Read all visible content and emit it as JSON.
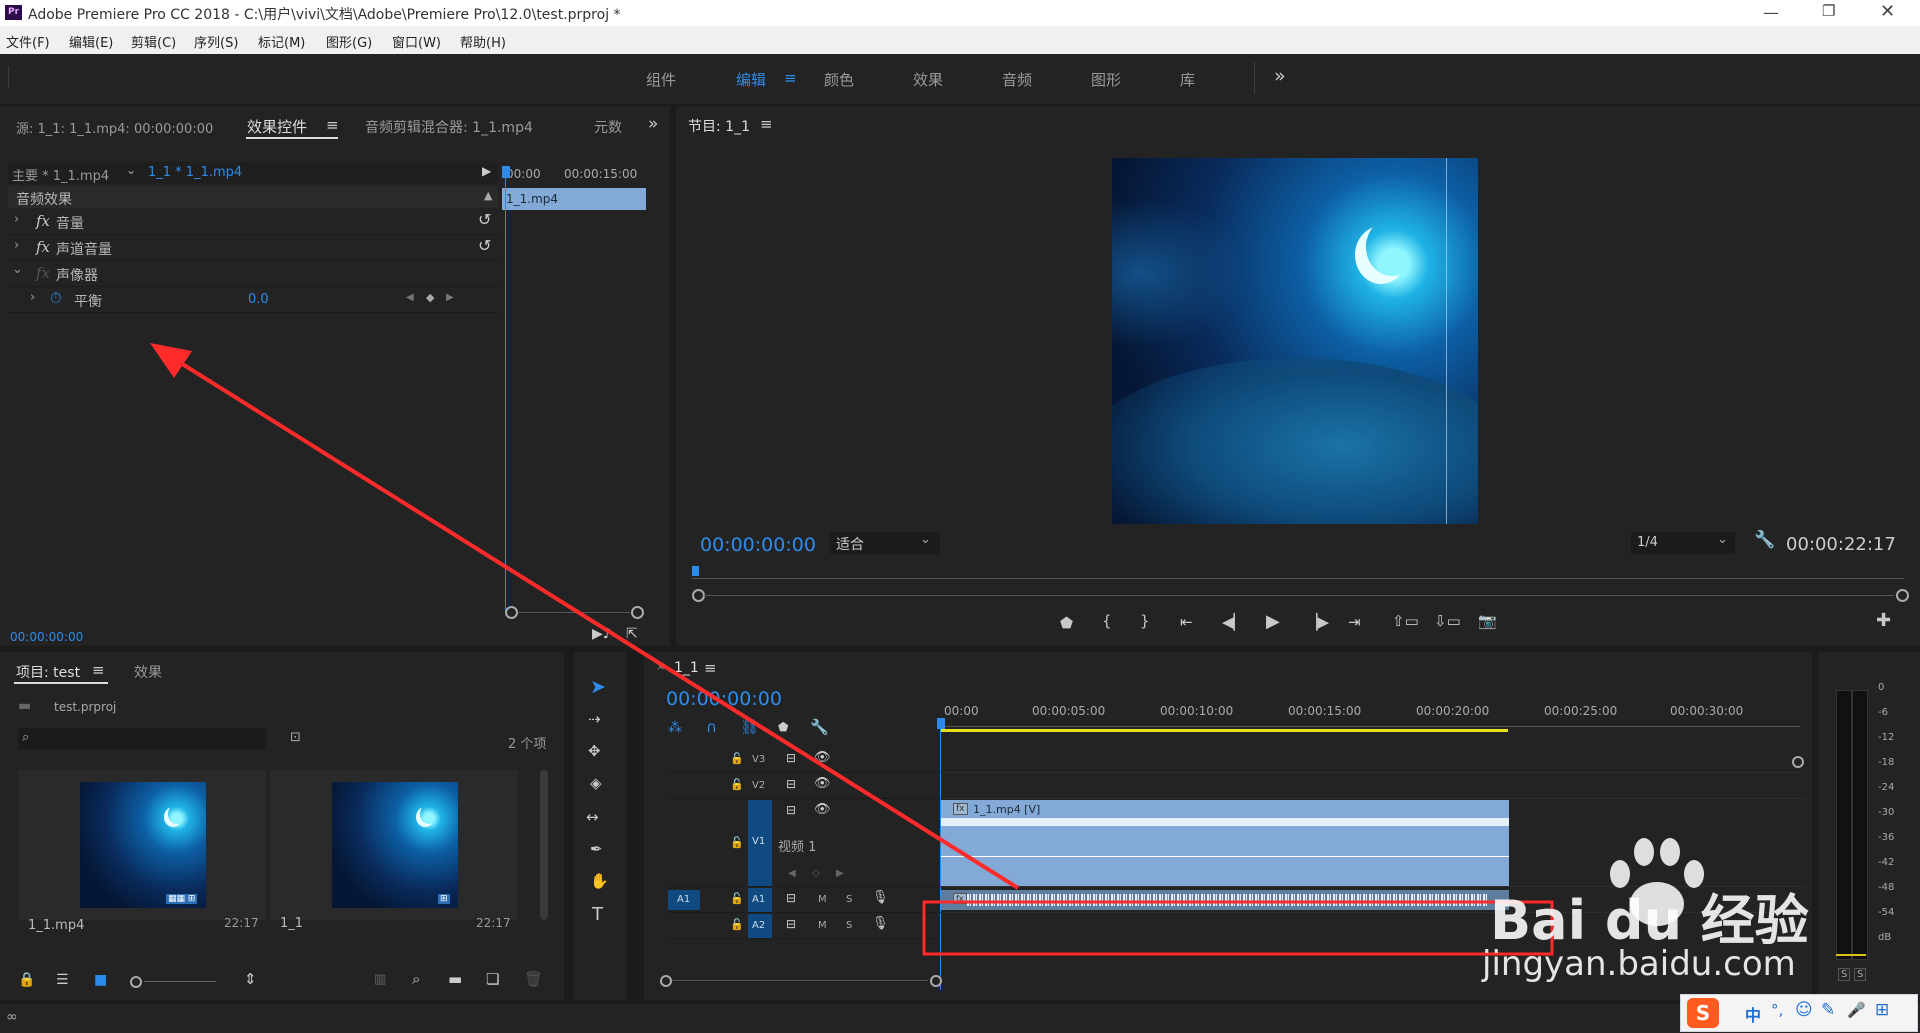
{
  "window": {
    "app_icon": "Pr",
    "title": "Adobe Premiere Pro CC 2018 - C:\\用户\\vivi\\文档\\Adobe\\Premiere Pro\\12.0\\test.prproj *",
    "controls": [
      "minimize-icon",
      "restore-icon",
      "close-icon"
    ]
  },
  "menu": [
    "文件(F)",
    "编辑(E)",
    "剪辑(C)",
    "序列(S)",
    "标记(M)",
    "图形(G)",
    "窗口(W)",
    "帮助(H)"
  ],
  "workspaces": {
    "items": [
      "组件",
      "编辑",
      "颜色",
      "效果",
      "音频",
      "图形",
      "库"
    ],
    "active": "编辑",
    "more": "»"
  },
  "source_panel": {
    "tabs": [
      "源: 1_1: 1_1.mp4: 00:00:00:00",
      "效果控件",
      "音频剪辑混合器: 1_1.mp4",
      "元数"
    ],
    "active_tab": "效果控件",
    "master_label": "主要 * 1_1.mp4",
    "clip_label": "1_1 * 1_1.mp4",
    "ruler": [
      "00:00",
      "00:00:15:00"
    ],
    "clip_bar": "1_1.mp4",
    "section": "音频效果",
    "effects": [
      {
        "fx": "fx",
        "name": "音量"
      },
      {
        "fx": "fx",
        "name": "声道音量"
      },
      {
        "fx": "fx",
        "name": "声像器"
      }
    ],
    "param": {
      "name": "平衡",
      "value": "0.0"
    },
    "timecode": "00:00:00:00"
  },
  "program_panel": {
    "title": "节目: 1_1",
    "timecode": "00:00:00:00",
    "fit": "适合",
    "resolution": "1/4",
    "duration": "00:00:22:17"
  },
  "project_panel": {
    "tabs": [
      "项目: test",
      "效果"
    ],
    "file": "test.prproj",
    "count": "2 个项",
    "items": [
      {
        "name": "1_1.mp4",
        "duration": "22:17"
      },
      {
        "name": "1_1",
        "duration": "22:17"
      }
    ]
  },
  "timeline": {
    "tab": "1_1",
    "timecode": "00:00:00:00",
    "ruler": [
      "00:00",
      "00:00:05:00",
      "00:00:10:00",
      "00:00:15:00",
      "00:00:20:00",
      "00:00:25:00",
      "00:00:30:00"
    ],
    "tracks": {
      "video": [
        "V3",
        "V2",
        "V1"
      ],
      "audio": [
        "A1",
        "A2"
      ],
      "v1_name": "视频 1",
      "source_patch": "A1"
    },
    "video_clip": "1_1.mp4 [V]",
    "mute_label": "M",
    "solo_label": "S"
  },
  "meter": {
    "labels": [
      "0",
      "-6",
      "-12",
      "-18",
      "-24",
      "-30",
      "-36",
      "-42",
      "-48",
      "-54",
      "dB"
    ],
    "solo": [
      "S",
      "S"
    ]
  },
  "watermark": {
    "line1": "Bai du 经验",
    "line2": "jingyan.baidu.com"
  },
  "ime": {
    "items": [
      "中",
      "°,",
      "☺",
      "✎",
      "🎤",
      "⊞"
    ]
  },
  "colors": {
    "accent": "#2d8ceb",
    "annotation": "#ff2a2a",
    "clip": "#83a9d6"
  }
}
